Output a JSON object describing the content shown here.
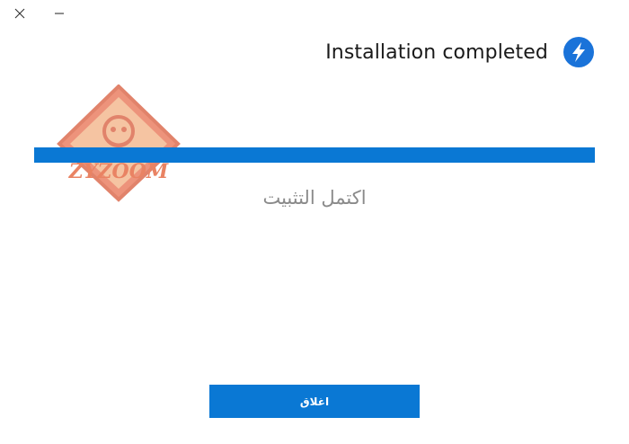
{
  "window": {
    "close_glyph": "✕",
    "minimize_glyph": "–"
  },
  "header": {
    "title": "Installation completed",
    "app_icon": "lightning-bolt-icon"
  },
  "progress": {
    "value_percent": 100
  },
  "status": {
    "message": "اكتمل التثبيت"
  },
  "actions": {
    "close_label": "اغلاق"
  },
  "watermark": {
    "text": "ZYZOOM"
  },
  "colors": {
    "accent": "#0a78d4",
    "status_text": "#8a8a8a",
    "watermark": "#e8704f"
  }
}
